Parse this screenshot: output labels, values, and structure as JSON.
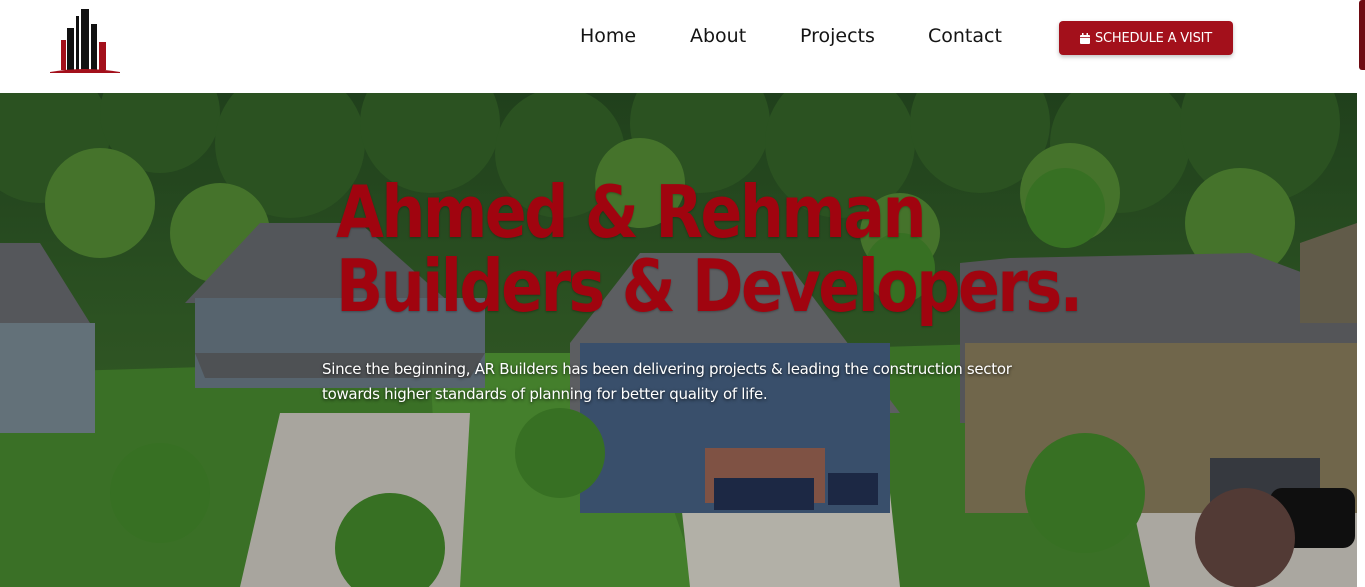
{
  "header": {
    "logo_icon": "building-logo-icon",
    "nav": [
      {
        "label": "Home"
      },
      {
        "label": "About"
      },
      {
        "label": "Projects"
      },
      {
        "label": "Contact"
      }
    ],
    "cta": {
      "label": "SCHEDULE A VISIT",
      "icon": "calendar-icon"
    }
  },
  "hero": {
    "title_line1": "Ahmed & Rehman",
    "title_line2": "Builders & Developers.",
    "subtitle": "Since the beginning, AR Builders has been delivering projects & leading the construction sector towards higher standards of planning for better quality of life."
  },
  "colors": {
    "brand_red": "#a3101b",
    "title_red": "#a0040f",
    "nav_text": "#141414",
    "header_bg": "#ffffff"
  }
}
